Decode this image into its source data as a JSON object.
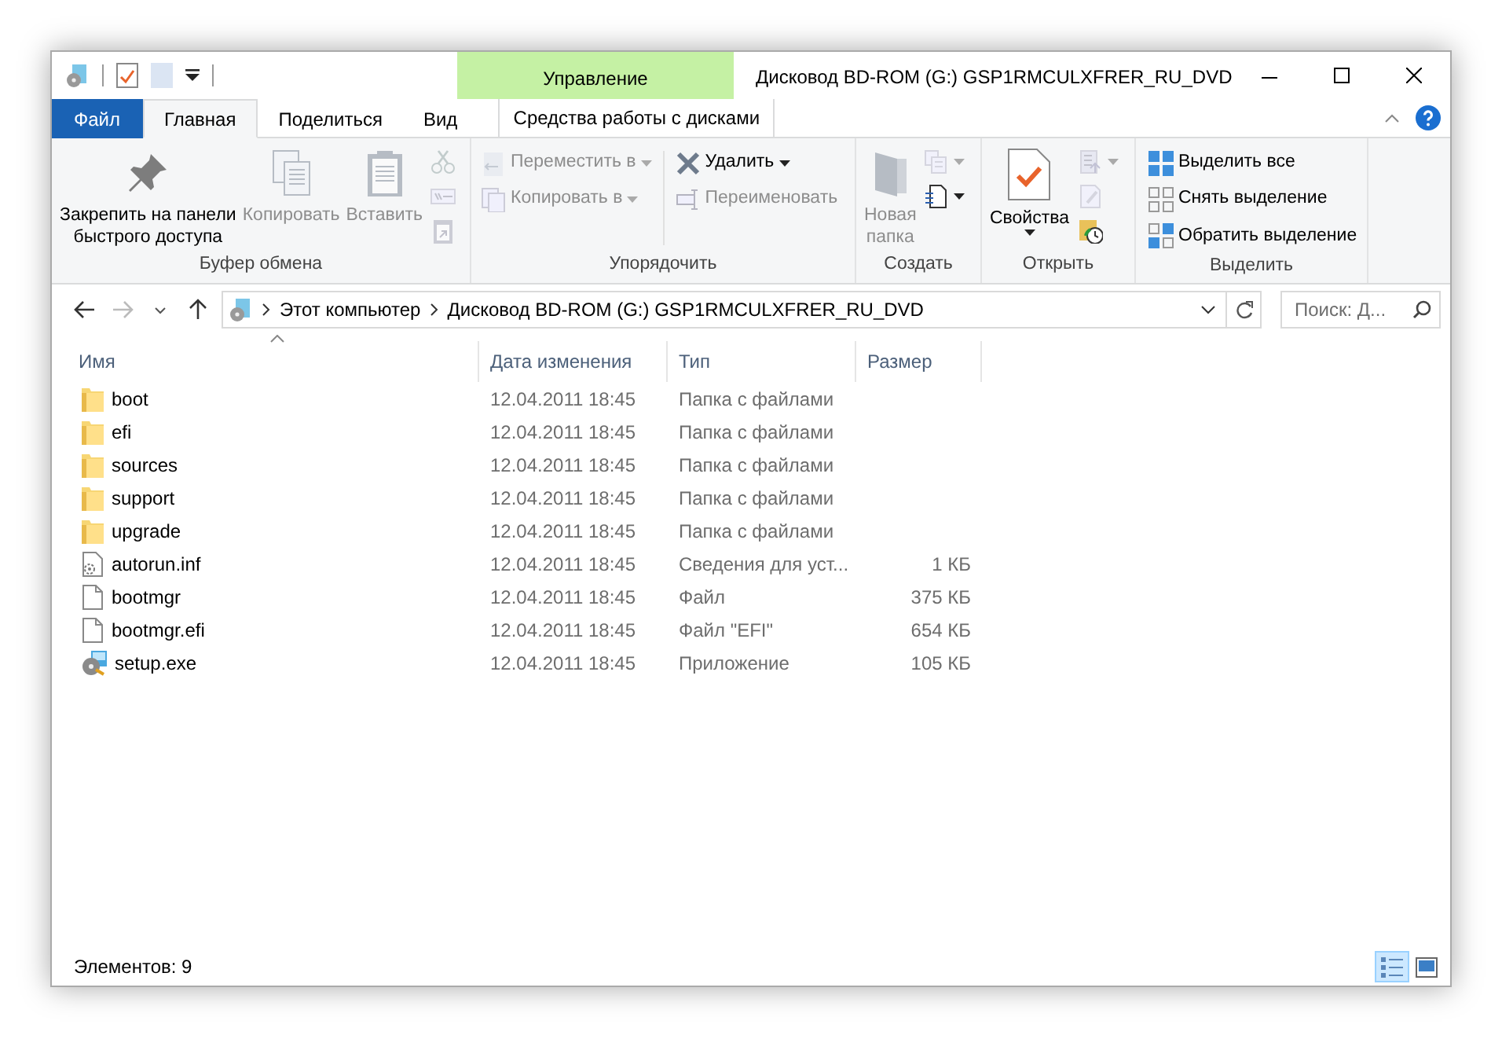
{
  "window": {
    "title": "Дисковод BD-ROM (G:) GSP1RMCULXFRER_RU_DVD"
  },
  "context_tab": {
    "group": "Управление",
    "label": "Средства работы с дисками"
  },
  "tabs": [
    {
      "label": "Файл",
      "kind": "file",
      "selected": false
    },
    {
      "label": "Главная",
      "kind": "tab",
      "selected": true
    },
    {
      "label": "Поделиться",
      "kind": "tab",
      "selected": false
    },
    {
      "label": "Вид",
      "kind": "tab",
      "selected": false
    }
  ],
  "ribbon_groups": [
    {
      "label": "Буфер обмена",
      "items": [
        {
          "kind": "large",
          "label": "Закрепить на панели\nбыстрого доступа",
          "disabled": false
        },
        {
          "kind": "large",
          "label": "Копировать",
          "disabled": true
        },
        {
          "kind": "large",
          "label": "Вставить",
          "disabled": true
        },
        {
          "kind": "stack",
          "items": [
            {
              "kind": "icon",
              "disabled": true
            },
            {
              "kind": "icon",
              "disabled": true
            },
            {
              "kind": "icon",
              "disabled": true
            }
          ]
        }
      ]
    },
    {
      "label": "Упорядочить",
      "items": [
        {
          "kind": "stack",
          "items": [
            {
              "kind": "small",
              "label": "Переместить в",
              "disabled": true,
              "dropdown": true
            },
            {
              "kind": "small",
              "label": "Копировать в",
              "disabled": true,
              "dropdown": true
            }
          ]
        },
        {
          "kind": "stack",
          "items": [
            {
              "kind": "small",
              "label": "Удалить",
              "disabled": false,
              "dropdown": true
            },
            {
              "kind": "small",
              "label": "Переименовать",
              "disabled": true,
              "dropdown": false
            }
          ]
        }
      ]
    },
    {
      "label": "Создать",
      "items": [
        {
          "kind": "large",
          "label": "Новая\nпапка",
          "disabled": true
        },
        {
          "kind": "stack",
          "items": [
            {
              "kind": "icon",
              "disabled": true,
              "dropdown": true
            },
            {
              "kind": "icon",
              "disabled": false,
              "dropdown": true
            }
          ]
        }
      ]
    },
    {
      "label": "Открыть",
      "items": [
        {
          "kind": "large",
          "label": "Свойства",
          "disabled": false,
          "dropdown": true
        },
        {
          "kind": "stack",
          "items": [
            {
              "kind": "icon",
              "disabled": true,
              "dropdown": true
            },
            {
              "kind": "icon",
              "disabled": true
            },
            {
              "kind": "icon",
              "disabled": false
            }
          ]
        }
      ]
    },
    {
      "label": "Выделить",
      "items": [
        {
          "kind": "stack",
          "items": [
            {
              "kind": "small",
              "label": "Выделить все",
              "disabled": false
            },
            {
              "kind": "small",
              "label": "Снять выделение",
              "disabled": false
            },
            {
              "kind": "small",
              "label": "Обратить выделение",
              "disabled": false
            }
          ]
        }
      ]
    }
  ],
  "address": {
    "path": [
      "Этот компьютер",
      "Дисковод BD-ROM (G:) GSP1RMCULXFRER_RU_DVD"
    ],
    "search_placeholder": "Поиск: Д..."
  },
  "columns": [
    "Имя",
    "Дата изменения",
    "Тип",
    "Размер"
  ],
  "rows": [
    {
      "kind": "folder",
      "name": "boot",
      "date": "12.04.2011 18:45",
      "type": "Папка с файлами"
    },
    {
      "kind": "folder",
      "name": "efi",
      "date": "12.04.2011 18:45",
      "type": "Папка с файлами"
    },
    {
      "kind": "folder",
      "name": "sources",
      "date": "12.04.2011 18:45",
      "type": "Папка с файлами"
    },
    {
      "kind": "folder",
      "name": "support",
      "date": "12.04.2011 18:45",
      "type": "Папка с файлами"
    },
    {
      "kind": "folder",
      "name": "upgrade",
      "date": "12.04.2011 18:45",
      "type": "Папка с файлами"
    },
    {
      "kind": "settings",
      "name": "autorun.inf",
      "date": "12.04.2011 18:45",
      "type": "Сведения для уст...",
      "size": "1 КБ"
    },
    {
      "kind": "file",
      "name": "bootmgr",
      "date": "12.04.2011 18:45",
      "type": "Файл",
      "size": "375 КБ"
    },
    {
      "kind": "file",
      "name": "bootmgr.efi",
      "date": "12.04.2011 18:45",
      "type": "Файл \"EFI\"",
      "size": "654 КБ"
    },
    {
      "kind": "setup",
      "name": "setup.exe",
      "date": "12.04.2011 18:45",
      "type": "Приложение",
      "size": "105 КБ"
    }
  ],
  "status_bar": {
    "text": "Элементов: 9",
    "views": [
      {
        "selected": true
      },
      {
        "selected": false
      }
    ]
  }
}
